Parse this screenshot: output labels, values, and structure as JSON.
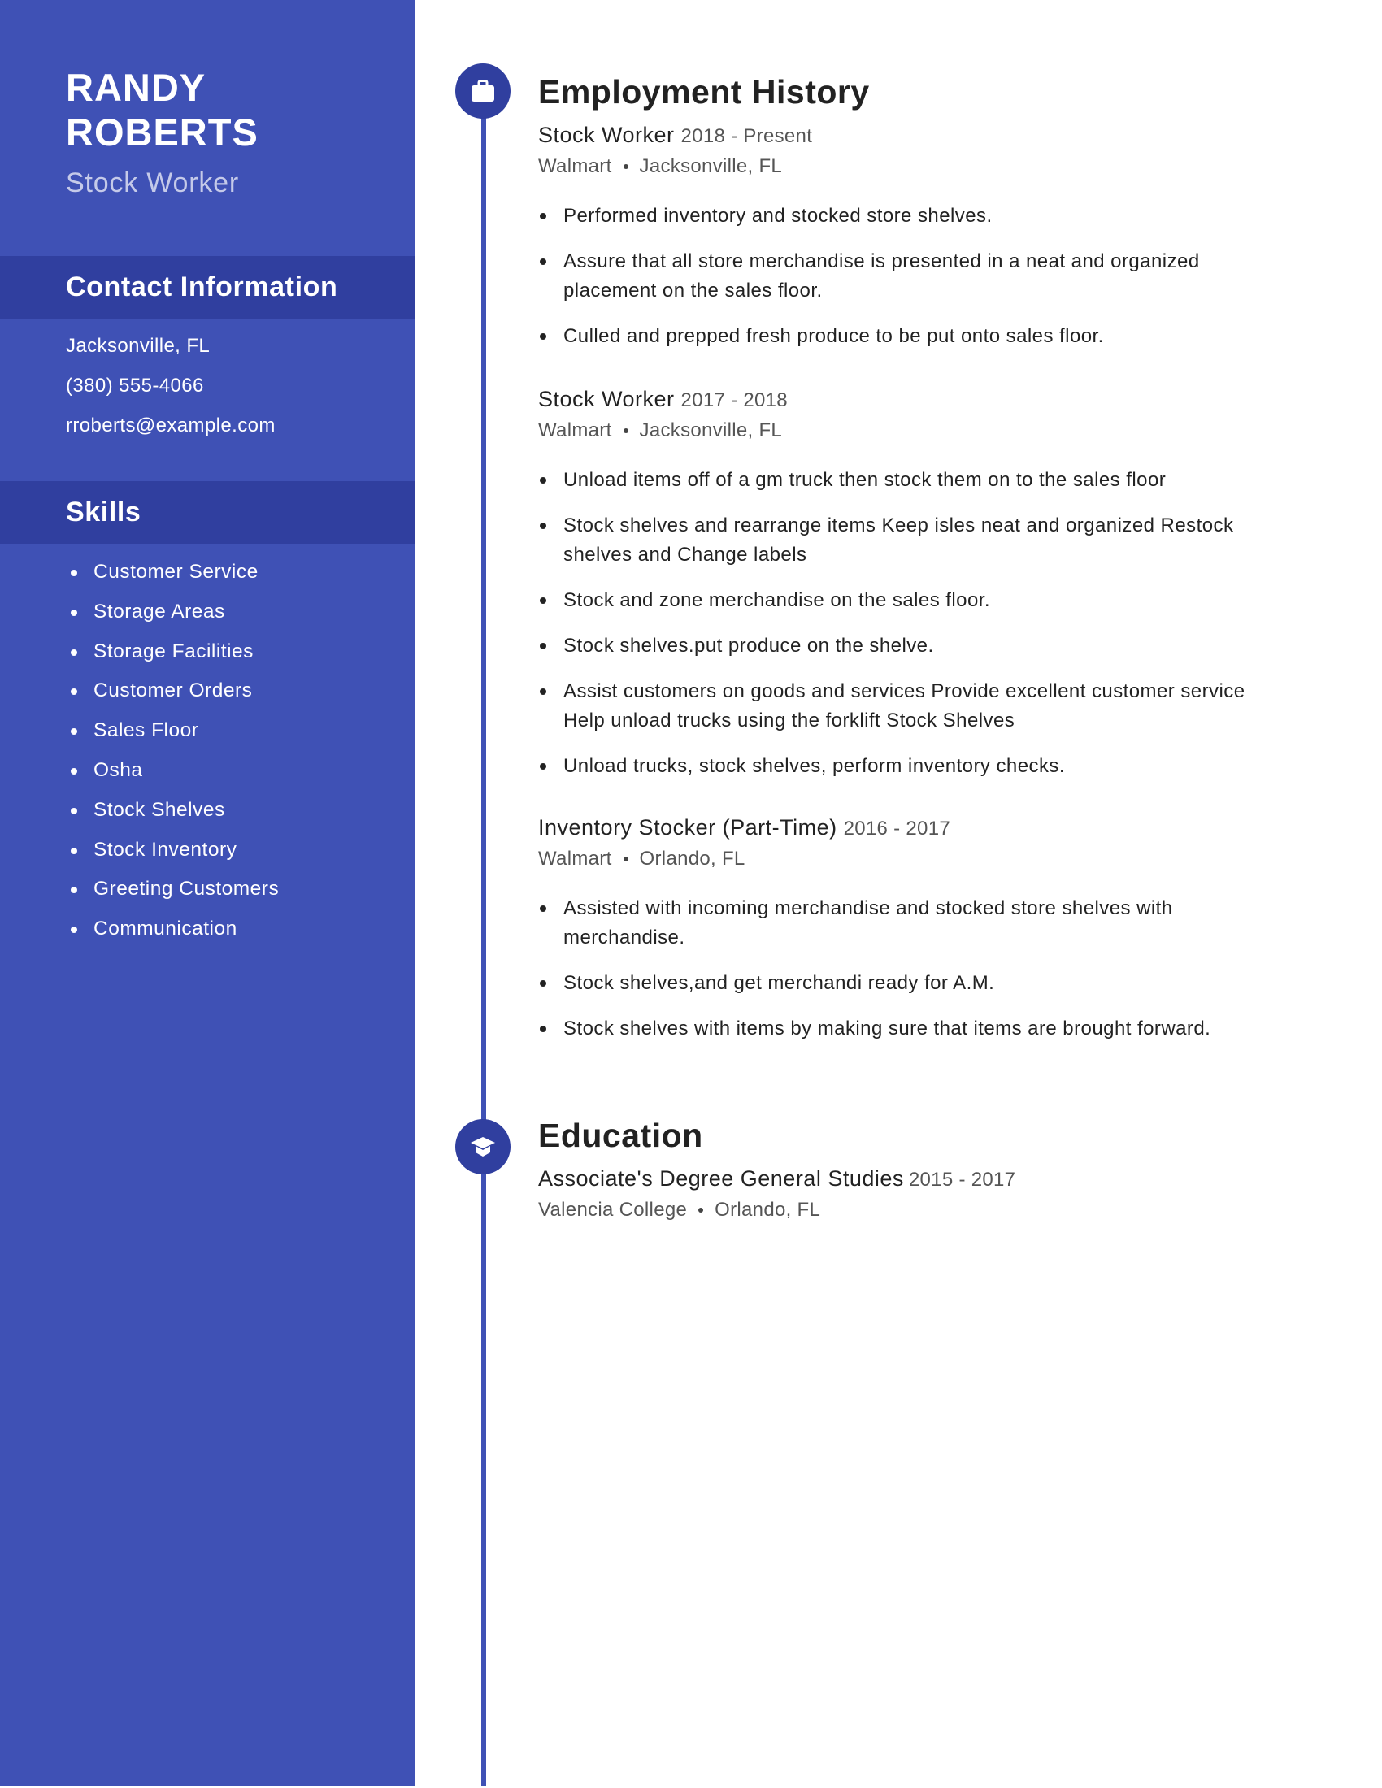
{
  "profile": {
    "first_name": "RANDY",
    "last_name": "ROBERTS",
    "title": "Stock Worker"
  },
  "contact": {
    "heading": "Contact Information",
    "location": "Jacksonville, FL",
    "phone": "(380) 555-4066",
    "email": "rroberts@example.com"
  },
  "skills": {
    "heading": "Skills",
    "items": [
      "Customer Service",
      "Storage Areas",
      "Storage Facilities",
      "Customer Orders",
      "Sales Floor",
      "Osha",
      "Stock Shelves",
      "Stock Inventory",
      "Greeting Customers",
      "Communication"
    ]
  },
  "employment": {
    "heading": "Employment History",
    "icon": "briefcase-icon",
    "jobs": [
      {
        "title": "Stock Worker",
        "dates": "2018 - Present",
        "employer": "Walmart",
        "location": "Jacksonville, FL",
        "bullets": [
          "Performed inventory and stocked store shelves.",
          "Assure that all store merchandise is presented in a neat and organized placement on the sales floor.",
          "Culled and prepped fresh produce to be put onto sales floor."
        ]
      },
      {
        "title": "Stock Worker",
        "dates": "2017 - 2018",
        "employer": "Walmart",
        "location": "Jacksonville, FL",
        "bullets": [
          "Unload items off of a gm truck then stock them on to the sales floor",
          "Stock shelves and rearrange items Keep isles neat and organized Restock shelves and Change labels",
          "Stock and zone merchandise on the sales floor.",
          "Stock shelves.put produce on the shelve.",
          "Assist customers on goods and services Provide excellent customer service Help unload trucks using the forklift Stock Shelves",
          "Unload trucks, stock shelves, perform inventory checks."
        ]
      },
      {
        "title": "Inventory Stocker (Part-Time)",
        "dates": "2016 - 2017",
        "employer": "Walmart",
        "location": "Orlando, FL",
        "bullets": [
          "Assisted with incoming merchandise and stocked store shelves with merchandise.",
          "Stock shelves,and get merchandi ready for A.M.",
          "Stock shelves with items by making sure that items are brought forward."
        ]
      }
    ]
  },
  "education": {
    "heading": "Education",
    "icon": "graduation-cap-icon",
    "entries": [
      {
        "degree": "Associate's Degree General Studies",
        "dates": "2015 - 2017",
        "school": "Valencia College",
        "location": "Orlando, FL"
      }
    ]
  },
  "colors": {
    "sidebar": "#3f51b5",
    "sidebar_band": "#303f9f",
    "accent_circle": "#303f9f",
    "timeline": "#3f51b5",
    "subtitle": "#c5cae9",
    "text": "#222222",
    "muted": "#555555"
  }
}
